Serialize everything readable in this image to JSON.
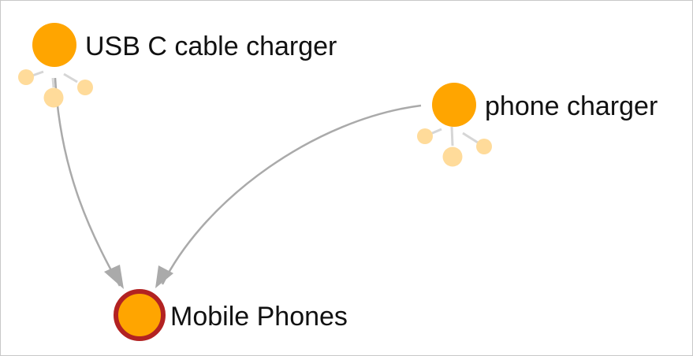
{
  "graph": {
    "nodes": {
      "usb_c_cable_charger": {
        "label": "USB C cable charger"
      },
      "phone_charger": {
        "label": "phone charger"
      },
      "mobile_phones": {
        "label": "Mobile Phones"
      }
    },
    "edges": [
      {
        "from": "usb_c_cable_charger",
        "to": "mobile_phones"
      },
      {
        "from": "phone_charger",
        "to": "mobile_phones"
      }
    ],
    "colors": {
      "node_fill": "#ffa500",
      "collapsed_child_fill": "#ffdb9a",
      "selected_ring": "#b22222",
      "edge": "#aaaaaa",
      "frame_border": "#c8c8c8"
    }
  }
}
